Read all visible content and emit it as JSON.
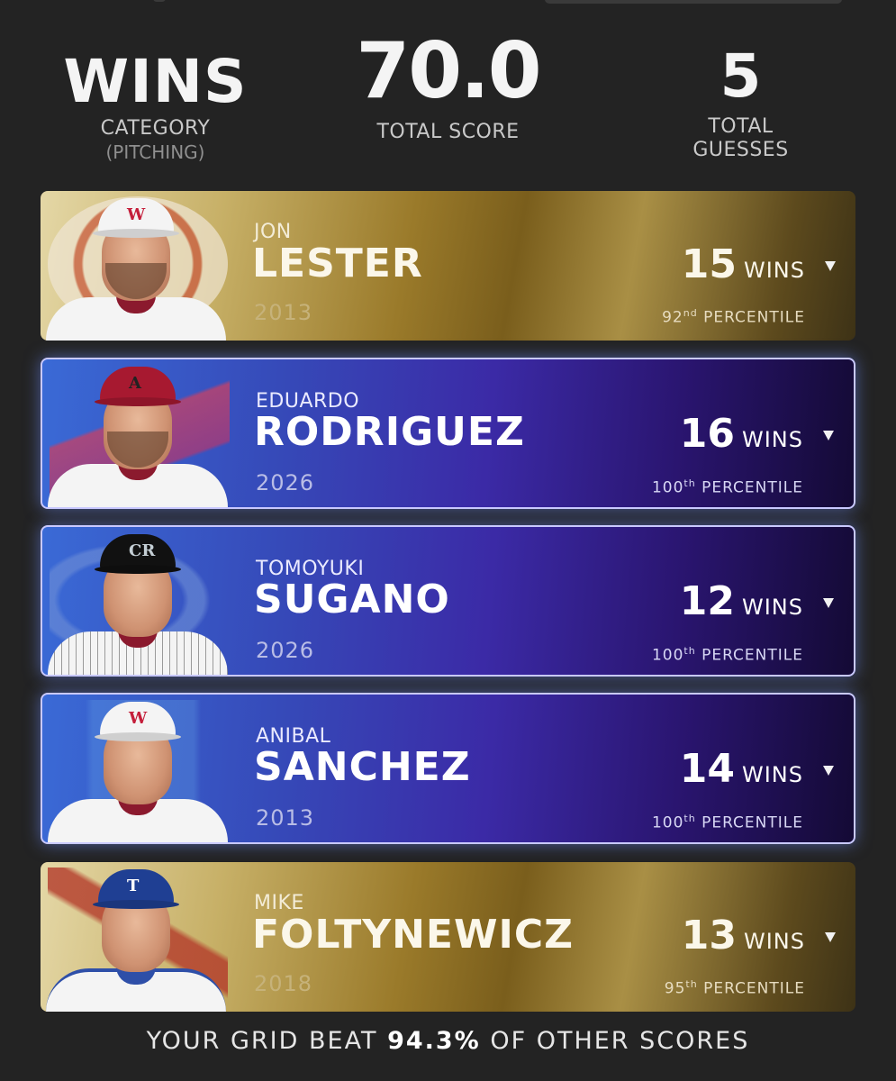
{
  "header": {
    "category": {
      "value": "WINS",
      "label": "CATEGORY",
      "sub": "(PITCHING)"
    },
    "score": {
      "value": "70.0",
      "label": "TOTAL SCORE"
    },
    "guesses": {
      "value": "5",
      "label_line1": "TOTAL",
      "label_line2": "GUESSES"
    }
  },
  "players": [
    {
      "first": "JON",
      "last": "LESTER",
      "year": "2013",
      "wins": "15",
      "unit": "WINS",
      "pct_num": "92",
      "pct_suffix": "nd",
      "pct_label": "PERCENTILE",
      "style": "gold",
      "team_logo": "boston-red-sox-logo",
      "cap_color": "#f4f4f4",
      "cap_mark": "W",
      "cap_mark_color": "#c41e3a"
    },
    {
      "first": "EDUARDO",
      "last": "RODRIGUEZ",
      "year": "2026",
      "wins": "16",
      "unit": "WINS",
      "pct_num": "100",
      "pct_suffix": "th",
      "pct_label": "PERCENTILE",
      "style": "purple",
      "team_logo": "arizona-diamondbacks-logo",
      "cap_color": "#a71930",
      "cap_mark": "A",
      "cap_mark_color": "#222222"
    },
    {
      "first": "TOMOYUKI",
      "last": "SUGANO",
      "year": "2026",
      "wins": "12",
      "unit": "WINS",
      "pct_num": "100",
      "pct_suffix": "th",
      "pct_label": "PERCENTILE",
      "style": "purple",
      "team_logo": "colorado-rockies-logo",
      "cap_color": "#111111",
      "cap_mark": "CR",
      "cap_mark_color": "#c4ced4"
    },
    {
      "first": "ANIBAL",
      "last": "SANCHEZ",
      "year": "2013",
      "wins": "14",
      "unit": "WINS",
      "pct_num": "100",
      "pct_suffix": "th",
      "pct_label": "PERCENTILE",
      "style": "purple",
      "team_logo": "detroit-tigers-logo",
      "cap_color": "#f4f4f4",
      "cap_mark": "W",
      "cap_mark_color": "#c41e3a"
    },
    {
      "first": "MIKE",
      "last": "FOLTYNEWICZ",
      "year": "2018",
      "wins": "13",
      "unit": "WINS",
      "pct_num": "95",
      "pct_suffix": "th",
      "pct_label": "PERCENTILE",
      "style": "gold",
      "team_logo": "atlanta-braves-logo",
      "cap_color": "#1f3f93",
      "cap_mark": "T",
      "cap_mark_color": "#ffffff"
    }
  ],
  "footer": {
    "prefix": "YOUR GRID BEAT",
    "percent": "94.3%",
    "suffix": "OF OTHER SCORES"
  }
}
